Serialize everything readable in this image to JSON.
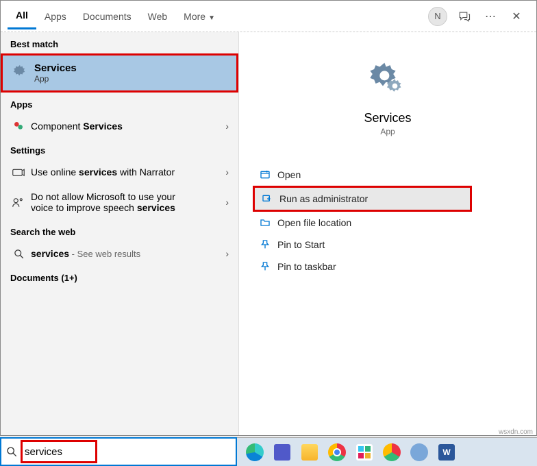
{
  "tabs": {
    "all": "All",
    "apps": "Apps",
    "documents": "Documents",
    "web": "Web",
    "more": "More"
  },
  "avatar_initial": "N",
  "left": {
    "best_match_label": "Best match",
    "best_match": {
      "title": "Services",
      "sub": "App"
    },
    "apps_label": "Apps",
    "component_prefix": "Component ",
    "component_bold": "Services",
    "settings_label": "Settings",
    "setting1_prefix": "Use online ",
    "setting1_bold": "services",
    "setting1_suffix": " with Narrator",
    "setting2_line1": "Do not allow Microsoft to use your",
    "setting2_line2_prefix": "voice to improve speech ",
    "setting2_line2_bold": "services",
    "search_web_label": "Search the web",
    "web_bold": "services",
    "web_suffix": " - See web results",
    "documents_label": "Documents (1+)"
  },
  "right": {
    "title": "Services",
    "sub": "App",
    "actions": {
      "open": "Open",
      "run_admin": "Run as administrator",
      "open_loc": "Open file location",
      "pin_start": "Pin to Start",
      "pin_taskbar": "Pin to taskbar"
    }
  },
  "search": {
    "value": "services"
  },
  "watermark": "wsxdn.com"
}
